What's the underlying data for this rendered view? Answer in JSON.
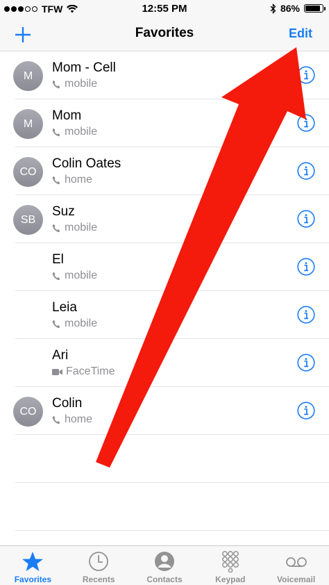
{
  "status_bar": {
    "carrier": "TFW",
    "time": "12:55 PM",
    "battery": "86%",
    "battery_level": 0.86
  },
  "nav": {
    "add_icon": "plus-icon",
    "title": "Favorites",
    "edit_label": "Edit"
  },
  "favorites": [
    {
      "initials": "M",
      "name": "Mom - Cell",
      "type": "mobile",
      "type_icon": "phone-icon"
    },
    {
      "initials": "M",
      "name": "Mom",
      "type": "mobile",
      "type_icon": "phone-icon"
    },
    {
      "initials": "CO",
      "name": "Colin Oates",
      "type": "home",
      "type_icon": "phone-icon"
    },
    {
      "initials": "SB",
      "name": "Suz",
      "type": "mobile",
      "type_icon": "phone-icon"
    },
    {
      "initials": "",
      "name": "El",
      "type": "mobile",
      "type_icon": "phone-icon"
    },
    {
      "initials": "",
      "name": "Leia",
      "type": "mobile",
      "type_icon": "phone-icon"
    },
    {
      "initials": "",
      "name": "Ari",
      "type": "FaceTime",
      "type_icon": "video-icon"
    },
    {
      "initials": "CO",
      "name": "Colin",
      "type": "home",
      "type_icon": "phone-icon"
    }
  ],
  "tabs": [
    {
      "label": "Favorites",
      "icon": "star-icon",
      "active": true
    },
    {
      "label": "Recents",
      "icon": "clock-icon",
      "active": false
    },
    {
      "label": "Contacts",
      "icon": "person-icon",
      "active": false
    },
    {
      "label": "Keypad",
      "icon": "keypad-icon",
      "active": false
    },
    {
      "label": "Voicemail",
      "icon": "voicemail-icon",
      "active": false
    }
  ],
  "colors": {
    "accent": "#1a7cf5",
    "annotation_arrow": "#f41a0c"
  }
}
